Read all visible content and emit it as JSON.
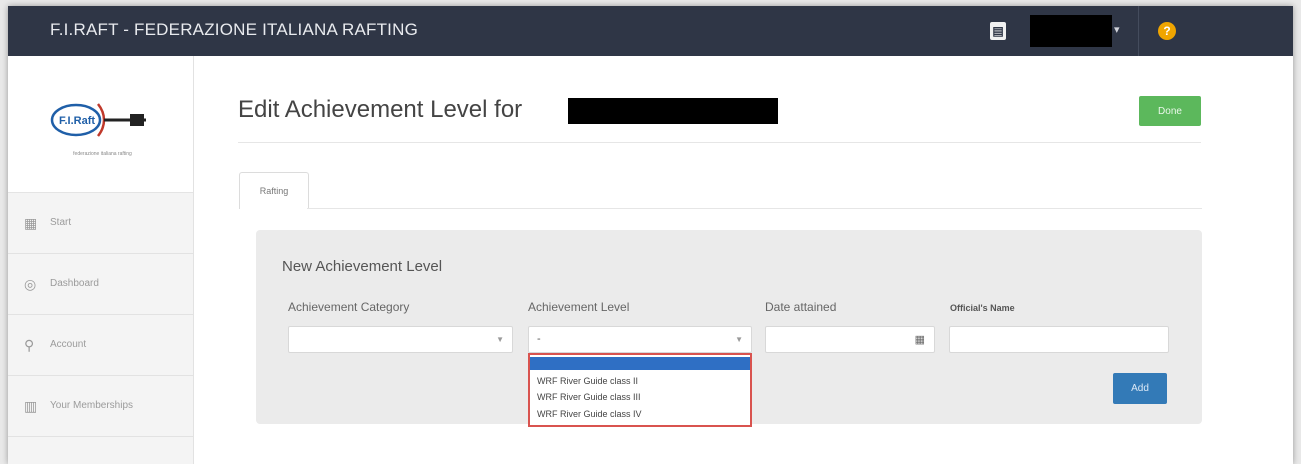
{
  "header": {
    "app_title": "F.I.RAFT - FEDERAZIONE ITALIANA RAFTING",
    "notice_icon": "clipboard-icon",
    "help_icon": "question-icon",
    "help_glyph": "?",
    "caret": "▾"
  },
  "sidebar": {
    "logo_text": "F.I.Raft",
    "logo_caption": "federazione italiana rafting",
    "items": [
      {
        "label": "Start",
        "icon": "start-icon"
      },
      {
        "label": "Dashboard",
        "icon": "dashboard-icon"
      },
      {
        "label": "Account",
        "icon": "account-icon"
      },
      {
        "label": "Your Memberships",
        "icon": "memberships-icon"
      }
    ]
  },
  "main": {
    "page_title": "Edit Achievement Level for",
    "done_label": "Done",
    "tabs": [
      {
        "label": "Rafting",
        "active": true
      }
    ],
    "panel": {
      "title": "New Achievement Level",
      "fields": {
        "category_label": "Achievement Category",
        "category_value": "",
        "level_label": "Achievement Level",
        "level_value": "-",
        "date_label": "Date attained",
        "date_value": "",
        "official_label": "Official's Name",
        "official_value": ""
      },
      "level_options": [
        {
          "label": "",
          "selected": true
        },
        {
          "label": "WRF River Guide class II",
          "selected": false
        },
        {
          "label": "WRF River Guide class III",
          "selected": false
        },
        {
          "label": "WRF River Guide class IV",
          "selected": false
        }
      ],
      "add_label": "Add"
    }
  },
  "colors": {
    "topbar": "#2f3646",
    "done": "#5cb85c",
    "add": "#337ab7",
    "dropdown_highlight": "#2f6fc4",
    "dropdown_outline": "#d9534f"
  }
}
